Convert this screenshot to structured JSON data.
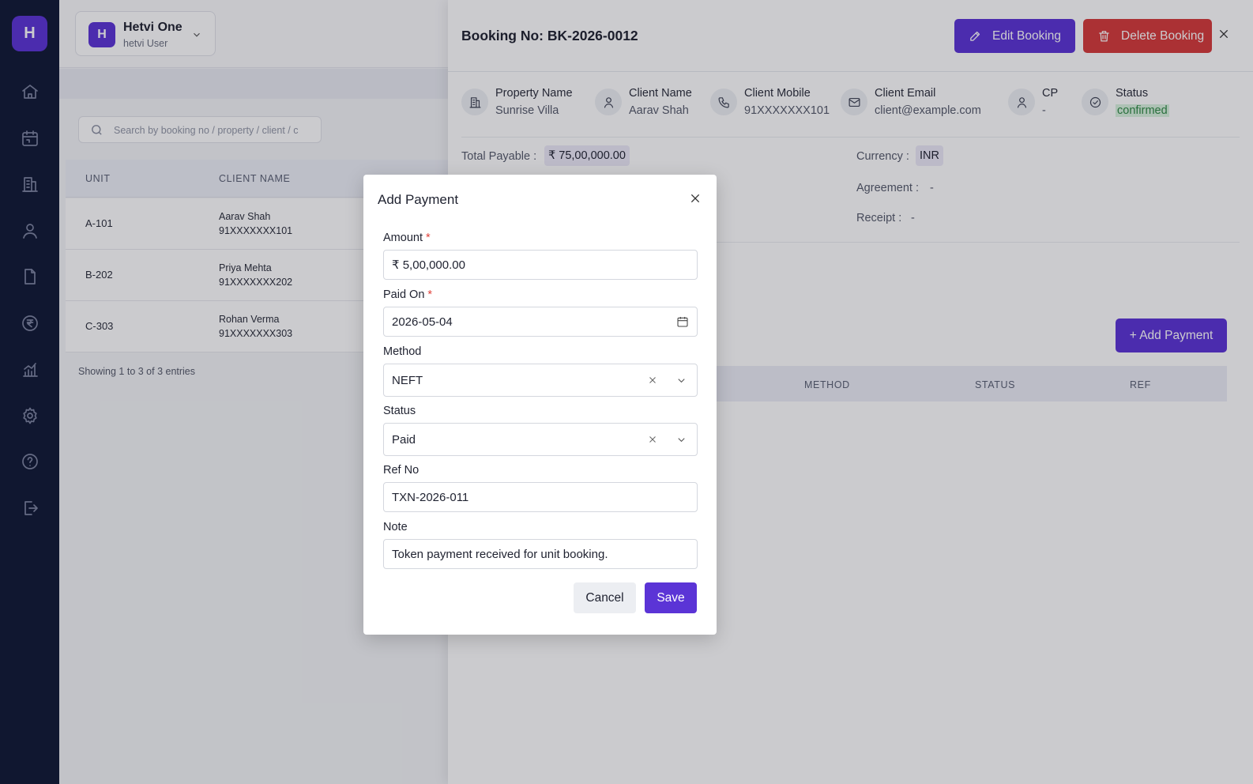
{
  "app": {
    "logo_letter": "H",
    "org_avatar_letter": "H",
    "org_name": "Hetvi One",
    "org_subtitle": "hetvi User",
    "accent_color": "#5b34d6",
    "danger_color": "#d63a3a"
  },
  "sidebar": {
    "items": [
      {
        "icon": "home-icon"
      },
      {
        "icon": "calendar-icon"
      },
      {
        "icon": "building-icon"
      },
      {
        "icon": "user-icon"
      },
      {
        "icon": "document-icon"
      },
      {
        "icon": "rupee-icon"
      },
      {
        "icon": "chart-icon"
      },
      {
        "icon": "gear-icon"
      },
      {
        "icon": "help-icon"
      },
      {
        "icon": "logout-icon"
      }
    ]
  },
  "list": {
    "search_placeholder": "Search by booking no / property / client / c",
    "columns": [
      "UNIT",
      "CLIENT NAME"
    ],
    "rows": [
      {
        "unit": "A-101",
        "client": "Aarav Shah",
        "mobile": "91XXXXXXX101"
      },
      {
        "unit": "B-202",
        "client": "Priya Mehta",
        "mobile": "91XXXXXXX202"
      },
      {
        "unit": "C-303",
        "client": "Rohan Verma",
        "mobile": "91XXXXXXX303"
      }
    ],
    "entries_text": "Showing 1 to 3 of 3 entries"
  },
  "drawer": {
    "title": "Booking No: BK-2026-0012",
    "edit_label": "Edit Booking",
    "delete_label": "Delete Booking",
    "info": {
      "property_label": "Property Name",
      "property_value": "Sunrise Villa",
      "client_label": "Client Name",
      "client_value": "Aarav Shah",
      "mobile_label": "Client Mobile",
      "mobile_value": "91XXXXXXX101",
      "email_label": "Client Email",
      "email_value": "client@example.com",
      "cp_label": "CP",
      "cp_value": "-",
      "status_label": "Status",
      "status_value": "confirmed"
    },
    "total_payable_label": "Total Payable :",
    "total_payable_value": "₹ 75,00,000.00",
    "currency_label": "Currency :",
    "currency_value": "INR",
    "agreement_label": "Agreement :",
    "agreement_value": "-",
    "receipt_label": "Receipt :",
    "receipt_value": "-",
    "add_payment_label": "+ Add Payment",
    "payments_columns": [
      "METHOD",
      "STATUS",
      "REF"
    ]
  },
  "modal": {
    "title": "Add Payment",
    "amount_label": "Amount",
    "amount_value": "₹ 5,00,000.00",
    "paid_on_label": "Paid On",
    "paid_on_value": "2026-05-04",
    "method_label": "Method",
    "method_value": "NEFT",
    "status_label": "Status",
    "status_value": "Paid",
    "ref_label": "Ref No",
    "ref_value": "TXN-2026-011",
    "note_label": "Note",
    "note_value": "Token payment received for unit booking.",
    "required_mark": "*",
    "cancel_label": "Cancel",
    "save_label": "Save"
  }
}
